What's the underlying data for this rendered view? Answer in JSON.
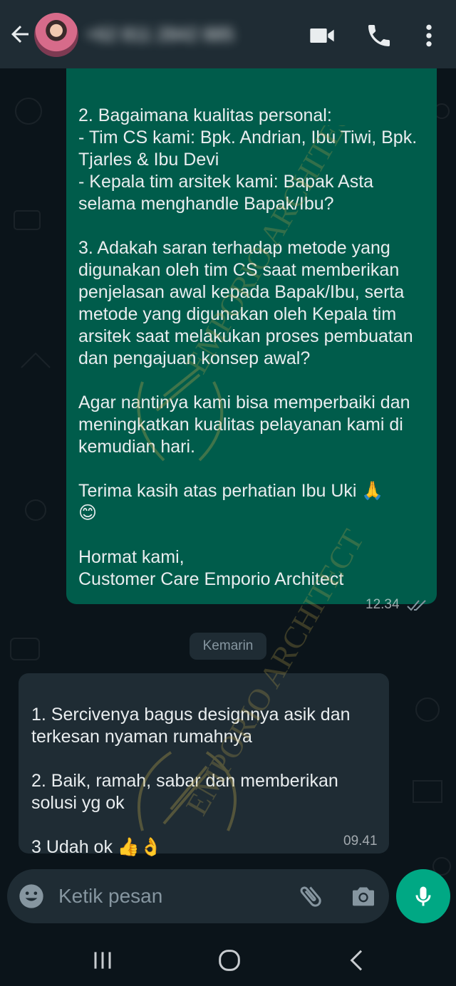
{
  "header": {
    "contact_name": "+62 811 2842 885",
    "icons": {
      "back": "arrow-back-icon",
      "video": "video-call-icon",
      "call": "voice-call-icon",
      "menu": "more-vert-icon"
    }
  },
  "messages": [
    {
      "direction": "outgoing",
      "text": "2. Bagaimana kualitas personal:\n- Tim CS kami: Bpk. Andrian, Ibu Tiwi, Bpk. Tjarles & Ibu Devi\n- Kepala tim arsitek kami: Bapak Asta selama menghandle Bapak/Ibu?\n\n3. Adakah saran terhadap metode yang digunakan oleh tim CS saat memberikan penjelasan awal kepada Bapak/Ibu, serta metode yang digunakan oleh Kepala tim arsitek saat melakukan proses pembuatan dan pengajuan konsep awal?\n\nAgar nantinya kami bisa memperbaiki dan meningkatkan kualitas pelayanan kami di kemudian hari.\n\nTerima kasih atas perhatian Ibu Uki 🙏\n😊\n\nHormat kami,\nCustomer Care Emporio Architect",
      "time": "12.34",
      "status": "read"
    },
    {
      "direction": "incoming",
      "text": "1. Sercivenya bagus designnya asik dan terkesan nyaman rumahnya\n\n2. Baik, ramah, sabar dan memberikan solusi yg ok\n\n3 Udah ok 👍👌",
      "time": "09.41"
    }
  ],
  "date_divider": "Kemarin",
  "watermark": "EMPORIO ARCHITECT",
  "input": {
    "placeholder": "Ketik pesan",
    "icons": {
      "emoji": "emoji-icon",
      "attach": "paperclip-icon",
      "camera": "camera-icon",
      "mic": "mic-icon"
    }
  },
  "colors": {
    "header_bg": "#1f2c34",
    "chat_bg": "#0b141a",
    "outgoing_bubble": "#005c4b",
    "incoming_bubble": "#1f2c34",
    "accent": "#00a884",
    "read_ticks": "#8696a0"
  },
  "system_nav": {
    "icons": [
      "recent-apps-icon",
      "home-icon",
      "back-nav-icon"
    ]
  }
}
